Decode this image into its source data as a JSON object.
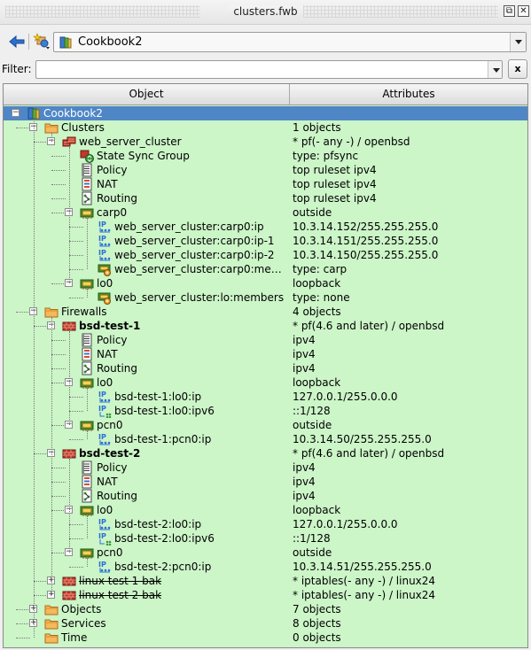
{
  "window": {
    "title": "clusters.fwb",
    "float_button": "⧉",
    "close_button": "✕"
  },
  "toolbar": {
    "back_icon": "back-arrow-icon",
    "new_object_icon": "new-object-icon",
    "library_combo": "Cookbook2"
  },
  "filter": {
    "label": "Filter:",
    "value": "",
    "clear_label": "x"
  },
  "tree": {
    "columns": [
      "Object",
      "Attributes"
    ],
    "rows": [
      {
        "depth": 0,
        "icon": "library",
        "name": "Cookbook2",
        "attr": "",
        "exp": "minus",
        "selected": true
      },
      {
        "depth": 1,
        "icon": "folder",
        "name": "Clusters",
        "attr": "1  objects",
        "exp": "minus"
      },
      {
        "depth": 2,
        "icon": "cluster",
        "name": "web_server_cluster",
        "attr": " * pf(- any -) / openbsd",
        "exp": "minus"
      },
      {
        "depth": 3,
        "icon": "sync",
        "name": "State Sync Group",
        "attr": "type: pfsync"
      },
      {
        "depth": 3,
        "icon": "policy",
        "name": "Policy",
        "attr": "top ruleset ipv4"
      },
      {
        "depth": 3,
        "icon": "nat",
        "name": "NAT",
        "attr": "top ruleset ipv4"
      },
      {
        "depth": 3,
        "icon": "routing",
        "name": "Routing",
        "attr": "top ruleset ipv4"
      },
      {
        "depth": 3,
        "icon": "interface",
        "name": "carp0",
        "attr": "outside",
        "exp": "minus"
      },
      {
        "depth": 4,
        "icon": "ip",
        "name": "web_server_cluster:carp0:ip",
        "attr": "10.3.14.152/255.255.255.0"
      },
      {
        "depth": 4,
        "icon": "ip",
        "name": "web_server_cluster:carp0:ip-1",
        "attr": "10.3.14.151/255.255.255.0"
      },
      {
        "depth": 4,
        "icon": "ip",
        "name": "web_server_cluster:carp0:ip-2",
        "attr": "10.3.14.150/255.255.255.0"
      },
      {
        "depth": 4,
        "icon": "members",
        "name": "web_server_cluster:carp0:me…",
        "attr": "type: carp"
      },
      {
        "depth": 3,
        "icon": "interface",
        "name": "lo0",
        "attr": "loopback",
        "exp": "minus"
      },
      {
        "depth": 4,
        "icon": "members",
        "name": "web_server_cluster:lo:members",
        "attr": "type: none"
      },
      {
        "depth": 1,
        "icon": "folder",
        "name": "Firewalls",
        "attr": "4  objects",
        "exp": "minus"
      },
      {
        "depth": 2,
        "icon": "firewall",
        "name": "bsd-test-1",
        "attr": " * pf(4.6 and later) / openbsd",
        "exp": "minus",
        "bold": true
      },
      {
        "depth": 3,
        "icon": "policy",
        "name": "Policy",
        "attr": "ipv4"
      },
      {
        "depth": 3,
        "icon": "nat",
        "name": "NAT",
        "attr": "ipv4"
      },
      {
        "depth": 3,
        "icon": "routing",
        "name": "Routing",
        "attr": "ipv4"
      },
      {
        "depth": 3,
        "icon": "interface",
        "name": "lo0",
        "attr": "loopback",
        "exp": "minus"
      },
      {
        "depth": 4,
        "icon": "ip",
        "name": "bsd-test-1:lo0:ip",
        "attr": "127.0.0.1/255.0.0.0"
      },
      {
        "depth": 4,
        "icon": "ipv6",
        "name": "bsd-test-1:lo0:ipv6",
        "attr": "::1/128"
      },
      {
        "depth": 3,
        "icon": "interface",
        "name": "pcn0",
        "attr": "outside",
        "exp": "minus"
      },
      {
        "depth": 4,
        "icon": "ip",
        "name": "bsd-test-1:pcn0:ip",
        "attr": "10.3.14.50/255.255.255.0"
      },
      {
        "depth": 2,
        "icon": "firewall",
        "name": "bsd-test-2",
        "attr": " * pf(4.6 and later) / openbsd",
        "exp": "minus",
        "bold": true
      },
      {
        "depth": 3,
        "icon": "policy",
        "name": "Policy",
        "attr": "ipv4"
      },
      {
        "depth": 3,
        "icon": "nat",
        "name": "NAT",
        "attr": "ipv4"
      },
      {
        "depth": 3,
        "icon": "routing",
        "name": "Routing",
        "attr": "ipv4"
      },
      {
        "depth": 3,
        "icon": "interface",
        "name": "lo0",
        "attr": "loopback",
        "exp": "minus"
      },
      {
        "depth": 4,
        "icon": "ip",
        "name": "bsd-test-2:lo0:ip",
        "attr": "127.0.0.1/255.0.0.0"
      },
      {
        "depth": 4,
        "icon": "ipv6",
        "name": "bsd-test-2:lo0:ipv6",
        "attr": "::1/128"
      },
      {
        "depth": 3,
        "icon": "interface",
        "name": "pcn0",
        "attr": "outside",
        "exp": "minus"
      },
      {
        "depth": 4,
        "icon": "ip",
        "name": "bsd-test-2:pcn0:ip",
        "attr": "10.3.14.51/255.255.255.0"
      },
      {
        "depth": 2,
        "icon": "firewall",
        "name": "linux test 1 bak",
        "attr": " * iptables(- any -) / linux24",
        "exp": "plus",
        "strike": true
      },
      {
        "depth": 2,
        "icon": "firewall",
        "name": "linux test 2 bak",
        "attr": " * iptables(- any -) / linux24",
        "exp": "plus",
        "strike": true
      },
      {
        "depth": 1,
        "icon": "folder",
        "name": "Objects",
        "attr": "7  objects",
        "exp": "plus"
      },
      {
        "depth": 1,
        "icon": "folder",
        "name": "Services",
        "attr": "8  objects",
        "exp": "plus"
      },
      {
        "depth": 1,
        "icon": "folder",
        "name": "Time",
        "attr": "0  objects"
      }
    ]
  },
  "colors": {
    "tree_background": "#ccf5c8",
    "selection": "#4f86c6",
    "folder": "#f2a54a",
    "firewall": "#c0392b",
    "interface": "#3e8e2f",
    "ip": "#2b6fd6"
  }
}
